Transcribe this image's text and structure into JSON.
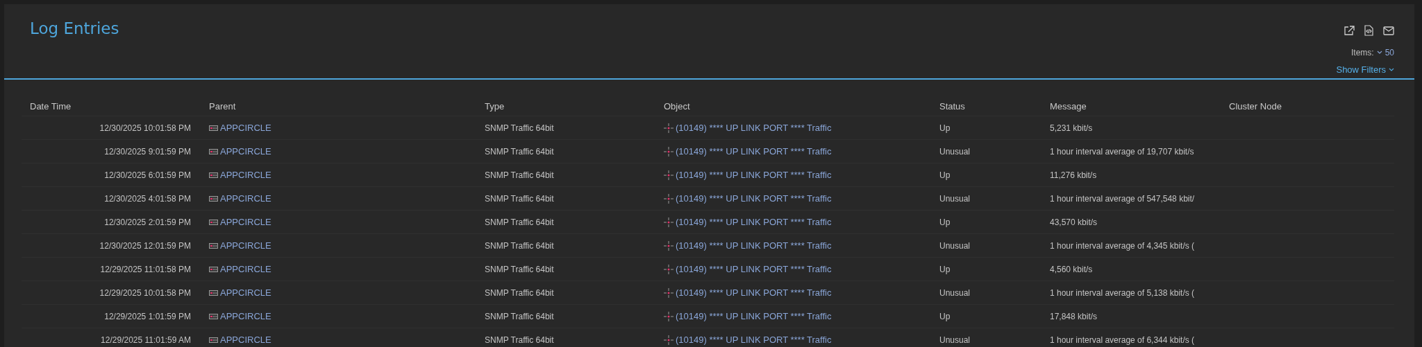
{
  "header": {
    "title": "Log Entries",
    "items_label": "Items:",
    "items_value": "50",
    "show_filters": "Show Filters"
  },
  "table": {
    "columns": [
      "Date Time",
      "Parent",
      "Type",
      "Object",
      "Status",
      "Message",
      "Cluster Node"
    ],
    "rows": [
      {
        "datetime": "12/30/2025 10:01:58 PM",
        "parent": "APPCIRCLE",
        "type": "SNMP Traffic 64bit",
        "object": "(10149) **** UP LINK PORT **** Traffic",
        "status": "Up",
        "message": "5,231 kbit/s"
      },
      {
        "datetime": "12/30/2025 9:01:59 PM",
        "parent": "APPCIRCLE",
        "type": "SNMP Traffic 64bit",
        "object": "(10149) **** UP LINK PORT **** Traffic",
        "status": "Unusual",
        "message": "1 hour interval average of 19,707 kbit/s"
      },
      {
        "datetime": "12/30/2025 6:01:59 PM",
        "parent": "APPCIRCLE",
        "type": "SNMP Traffic 64bit",
        "object": "(10149) **** UP LINK PORT **** Traffic",
        "status": "Up",
        "message": "11,276 kbit/s"
      },
      {
        "datetime": "12/30/2025 4:01:58 PM",
        "parent": "APPCIRCLE",
        "type": "SNMP Traffic 64bit",
        "object": "(10149) **** UP LINK PORT **** Traffic",
        "status": "Unusual",
        "message": "1 hour interval average of 547,548 kbit/"
      },
      {
        "datetime": "12/30/2025 2:01:59 PM",
        "parent": "APPCIRCLE",
        "type": "SNMP Traffic 64bit",
        "object": "(10149) **** UP LINK PORT **** Traffic",
        "status": "Up",
        "message": "43,570 kbit/s"
      },
      {
        "datetime": "12/30/2025 12:01:59 PM",
        "parent": "APPCIRCLE",
        "type": "SNMP Traffic 64bit",
        "object": "(10149) **** UP LINK PORT **** Traffic",
        "status": "Unusual",
        "message": "1 hour interval average of 4,345 kbit/s ("
      },
      {
        "datetime": "12/29/2025 11:01:58 PM",
        "parent": "APPCIRCLE",
        "type": "SNMP Traffic 64bit",
        "object": "(10149) **** UP LINK PORT **** Traffic",
        "status": "Up",
        "message": "4,560 kbit/s"
      },
      {
        "datetime": "12/29/2025 10:01:58 PM",
        "parent": "APPCIRCLE",
        "type": "SNMP Traffic 64bit",
        "object": "(10149) **** UP LINK PORT **** Traffic",
        "status": "Unusual",
        "message": "1 hour interval average of 5,138 kbit/s ("
      },
      {
        "datetime": "12/29/2025 1:01:59 PM",
        "parent": "APPCIRCLE",
        "type": "SNMP Traffic 64bit",
        "object": "(10149) **** UP LINK PORT **** Traffic",
        "status": "Up",
        "message": "17,848 kbit/s"
      },
      {
        "datetime": "12/29/2025 11:01:59 AM",
        "parent": "APPCIRCLE",
        "type": "SNMP Traffic 64bit",
        "object": "(10149) **** UP LINK PORT **** Traffic",
        "status": "Unusual",
        "message": "1 hour interval average of 6,344 kbit/s ("
      }
    ]
  }
}
